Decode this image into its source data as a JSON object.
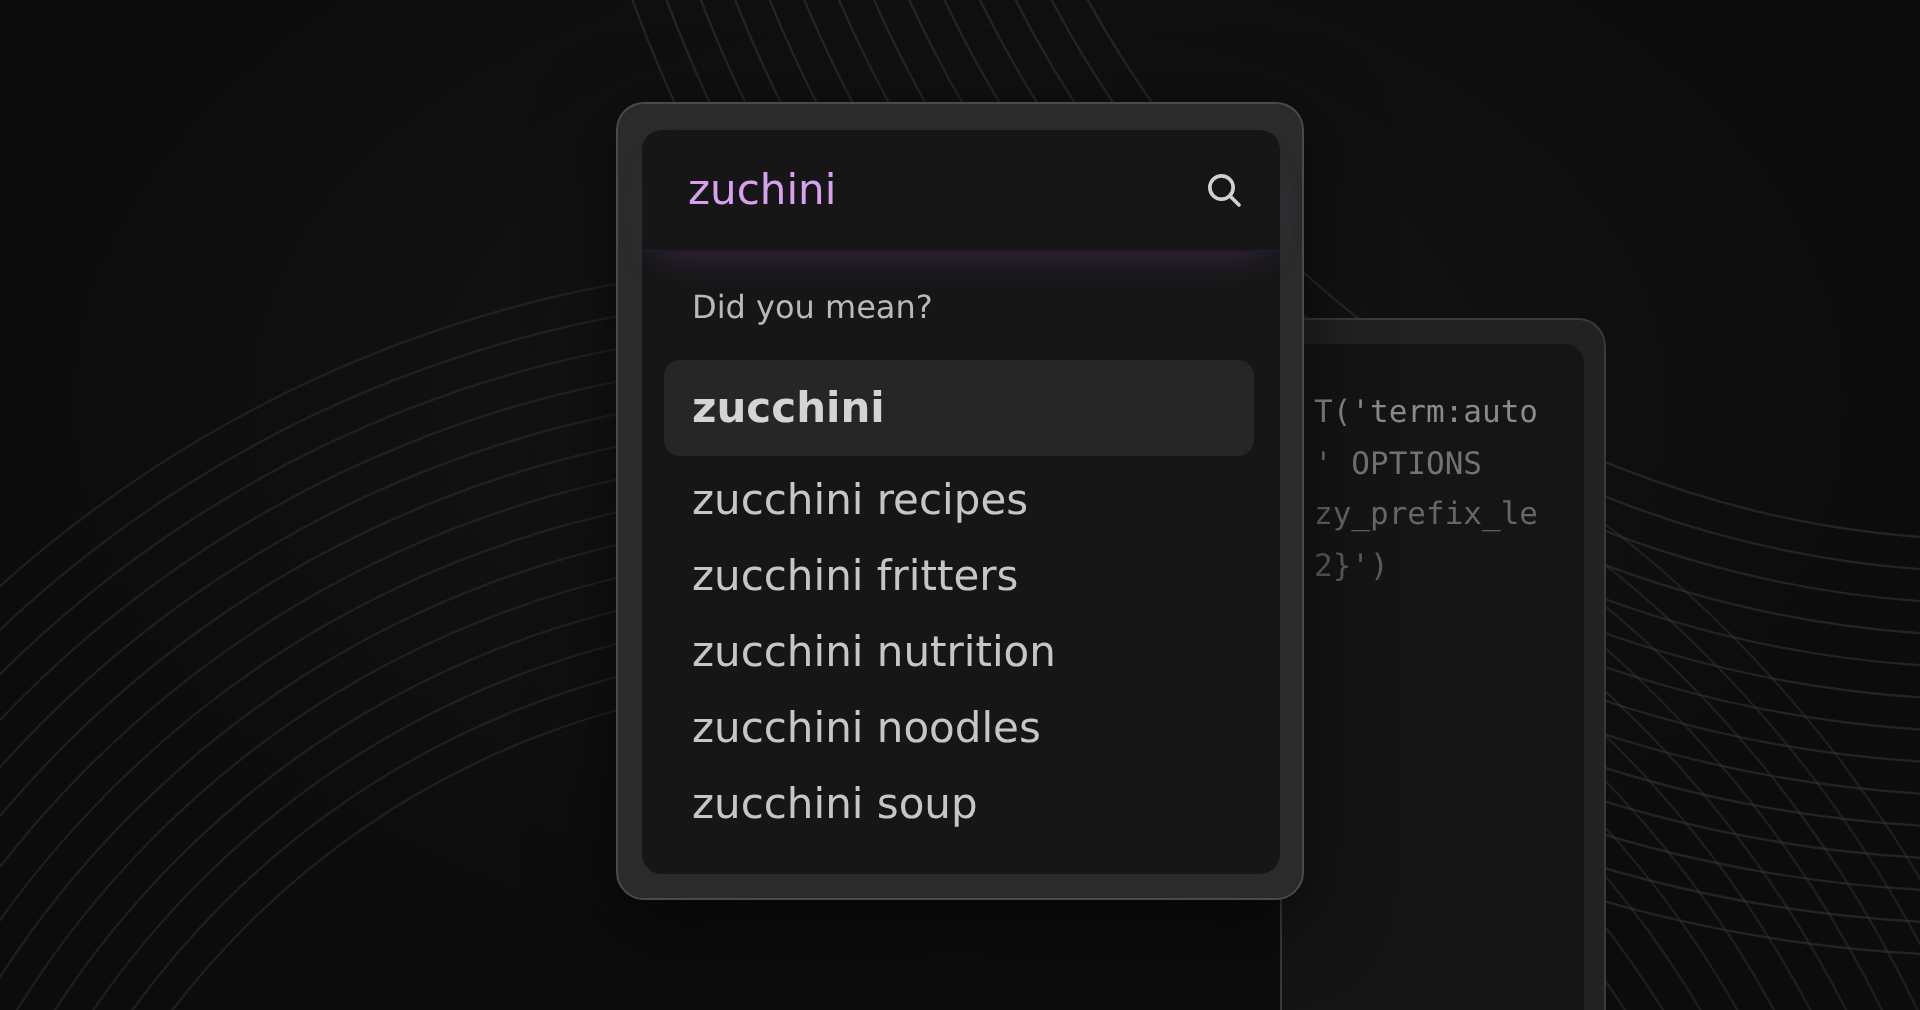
{
  "search": {
    "value": "zuchini"
  },
  "code_panel": {
    "lines": [
      "T('term:auto",
      "' OPTIONS",
      "zy_prefix_le",
      "2}')"
    ]
  },
  "suggestions_heading": "Did you mean?",
  "suggestions": [
    {
      "label": "zucchini",
      "selected": true
    },
    {
      "label": "zucchini recipes",
      "selected": false
    },
    {
      "label": "zucchini fritters",
      "selected": false
    },
    {
      "label": "zucchini nutrition",
      "selected": false
    },
    {
      "label": "zucchini noodles",
      "selected": false
    },
    {
      "label": "zucchini soup",
      "selected": false
    }
  ]
}
